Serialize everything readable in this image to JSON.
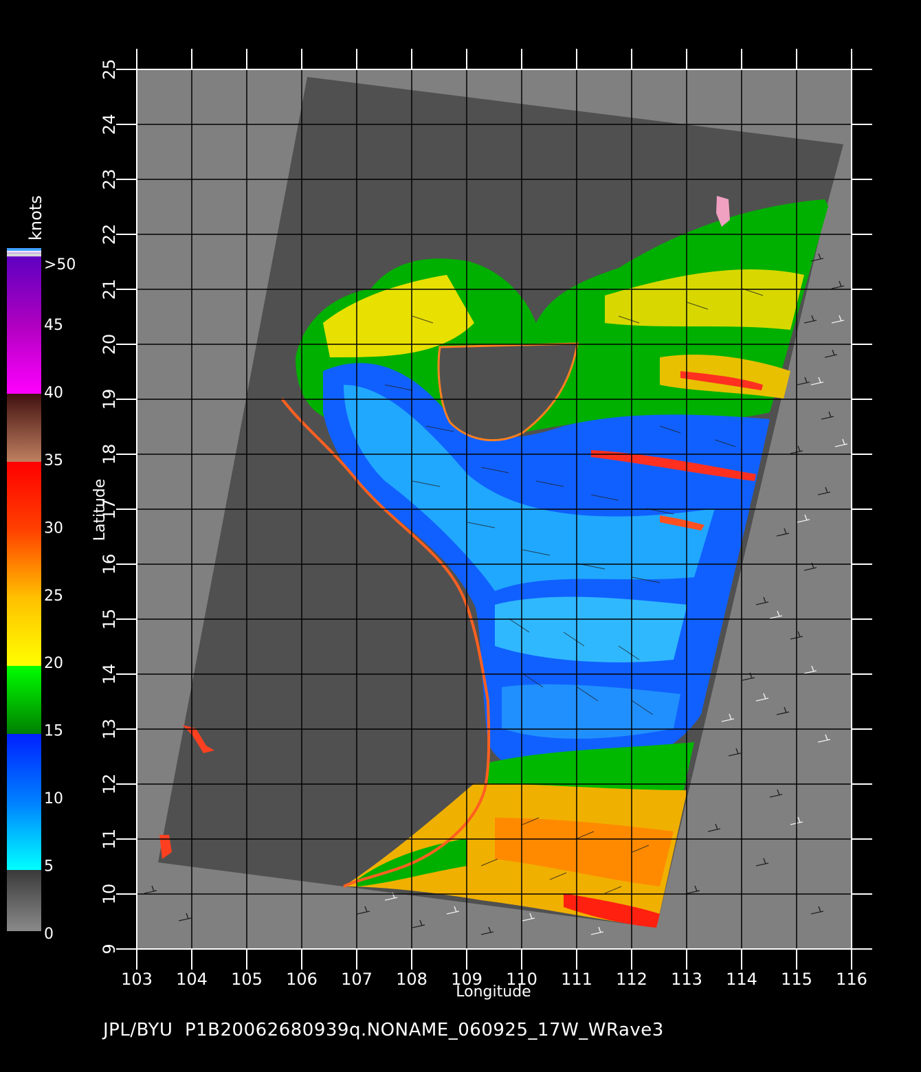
{
  "map": {
    "xlabel": "Longitude",
    "ylabel": "Latitude",
    "lon_ticks": [
      "103",
      "104",
      "105",
      "106",
      "107",
      "108",
      "109",
      "110",
      "111",
      "112",
      "113",
      "114",
      "115",
      "116"
    ],
    "lat_ticks": [
      "9",
      "10",
      "11",
      "12",
      "13",
      "14",
      "15",
      "16",
      "17",
      "18",
      "19",
      "20",
      "21",
      "22",
      "23",
      "24",
      "25"
    ],
    "lon_range": [
      103,
      116
    ],
    "lat_range": [
      9,
      25
    ],
    "grid": true
  },
  "colorbar": {
    "unit": "knots",
    "labels": [
      ">50",
      "45",
      "40",
      "35",
      "30",
      "25",
      "20",
      "15",
      "10",
      "5",
      "0"
    ],
    "colors": {
      "0-5": "#5a5a5a",
      "5-10": "#00e5ff",
      "10-15": "#0050ff",
      "15-20": "#00b000",
      "20-25": "#ffd400",
      "25-30": "#ff7000",
      "30-35": "#ff1a10",
      "35-40": "#8a4028",
      "40-45": "#ff00ff",
      "45-50": "#7a10d0"
    }
  },
  "footer": "JPL/BYU  P1B20062680939q.NONAME_060925_17W_WRave3"
}
